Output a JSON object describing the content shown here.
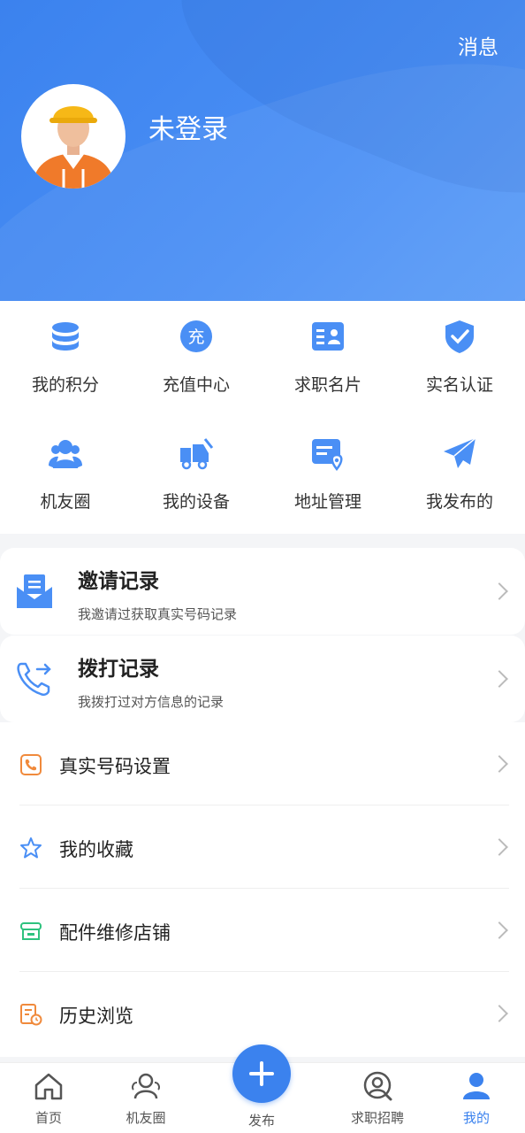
{
  "header": {
    "message_link": "消息",
    "user_name": "未登录"
  },
  "grid": {
    "items": [
      {
        "label": "我的积分",
        "icon": "coins-icon"
      },
      {
        "label": "充值中心",
        "icon": "recharge-icon",
        "icon_text": "充"
      },
      {
        "label": "求职名片",
        "icon": "id-card-icon"
      },
      {
        "label": "实名认证",
        "icon": "shield-check-icon"
      },
      {
        "label": "机友圈",
        "icon": "people-icon"
      },
      {
        "label": "我的设备",
        "icon": "truck-icon"
      },
      {
        "label": "地址管理",
        "icon": "location-card-icon"
      },
      {
        "label": "我发布的",
        "icon": "paper-plane-icon"
      }
    ]
  },
  "cards": [
    {
      "title": "邀请记录",
      "subtitle": "我邀请过获取真实号码记录",
      "icon": "mail-tray-icon"
    },
    {
      "title": "拨打记录",
      "subtitle": "我拨打过对方信息的记录",
      "icon": "phone-outgoing-icon"
    }
  ],
  "list": [
    {
      "label": "真实号码设置",
      "icon": "phone-settings-icon"
    },
    {
      "label": "我的收藏",
      "icon": "star-icon"
    },
    {
      "label": "配件维修店铺",
      "icon": "shop-icon"
    },
    {
      "label": "历史浏览",
      "icon": "history-icon"
    }
  ],
  "tabbar": {
    "tabs": [
      {
        "label": "首页",
        "icon": "home-icon"
      },
      {
        "label": "机友圈",
        "icon": "friends-icon"
      },
      {
        "label": "求职招聘",
        "icon": "job-search-icon"
      },
      {
        "label": "我的",
        "icon": "user-icon"
      }
    ],
    "publish_label": "发布",
    "active": "我的"
  },
  "colors": {
    "primary": "#3b82ee",
    "icon_blue": "#4a8ff5",
    "orange": "#f08a3c",
    "green": "#2ec27e"
  }
}
